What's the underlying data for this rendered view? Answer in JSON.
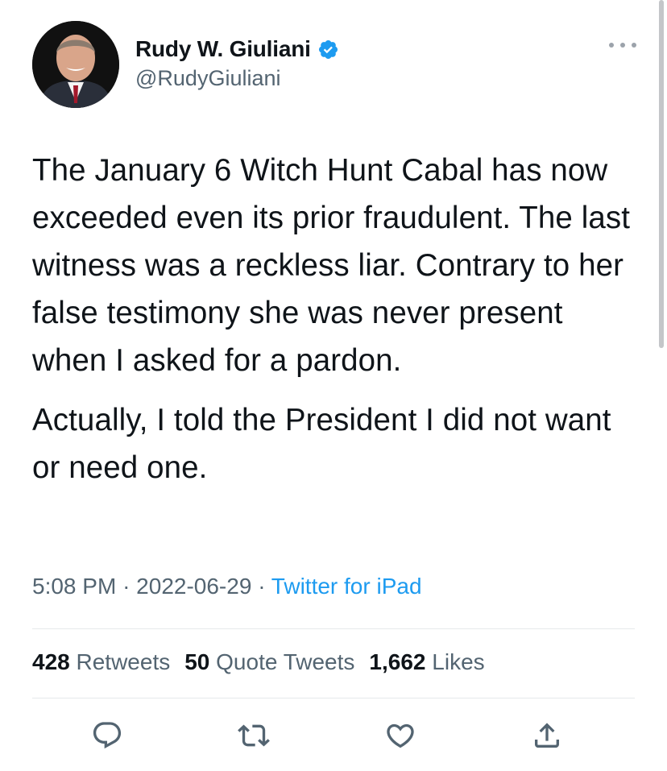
{
  "author": {
    "display_name": "Rudy W. Giuliani",
    "handle": "@RudyGiuliani",
    "verified": true
  },
  "tweet": {
    "paragraphs": [
      "The January 6 Witch Hunt Cabal has now exceeded even its prior fraudulent. The last witness was a reckless liar. Contrary to her false testimony she was never present when I asked for a pardon.",
      "Actually, I told the President I did not want or need one."
    ],
    "time": "5:08 PM",
    "date": "2022-06-29",
    "separator": "·",
    "source": "Twitter for iPad"
  },
  "stats": {
    "retweets_count": "428",
    "retweets_label": "Retweets",
    "quotes_count": "50",
    "quotes_label": "Quote Tweets",
    "likes_count": "1,662",
    "likes_label": "Likes"
  },
  "icons": {
    "verified": "verified-badge-icon",
    "more": "more-icon",
    "reply": "reply-icon",
    "retweet": "retweet-icon",
    "like": "like-icon",
    "share": "share-icon"
  },
  "colors": {
    "accent": "#1d9bf0",
    "text": "#0f1419",
    "secondary": "#536471"
  }
}
